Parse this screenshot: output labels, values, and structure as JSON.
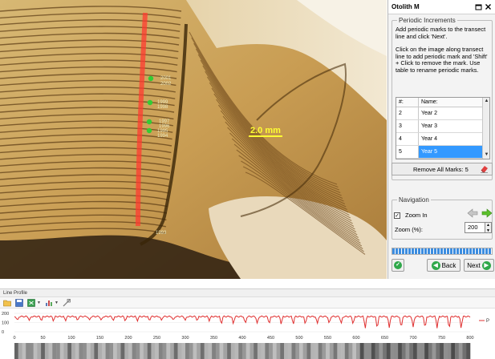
{
  "image": {
    "mark_labels": [
      "2001",
      "2002",
      "1999",
      "1998",
      "1997",
      "1996",
      "1995",
      "1994",
      "1993"
    ],
    "scale_label": "2.0 mm"
  },
  "panel": {
    "title": "Otolith M",
    "periodic": {
      "legend": "Periodic Increments",
      "instruction1": "Add periodic marks to the transect line and click 'Next'.",
      "instruction2": "Click on the image along transect line to add periodic mark and 'Shift' + Click to remove the mark. Use table to rename periodic marks.",
      "table": {
        "col_num": "#:",
        "col_name": "Name:",
        "rows": [
          {
            "num": "2",
            "name": "Year 2"
          },
          {
            "num": "3",
            "name": "Year 3"
          },
          {
            "num": "4",
            "name": "Year 4"
          },
          {
            "num": "5",
            "name": "Year 5"
          }
        ],
        "selected_index": 3
      },
      "remove_label": "Remove All Marks: 5"
    },
    "navigation": {
      "legend": "Navigation",
      "zoom_in_label": "Zoom In",
      "zoom_in_checked": true,
      "zoom_label": "Zoom (%):",
      "zoom_value": "200"
    },
    "progress_fraction": 1.0,
    "back_label": "Back",
    "next_label": "Next"
  },
  "line_profile": {
    "title": "Line Profile",
    "y_ticks": [
      "200",
      "100",
      "0"
    ],
    "x_ticks": [
      "0",
      "50",
      "100",
      "150",
      "200",
      "250",
      "300",
      "350",
      "400",
      "450",
      "500",
      "550",
      "600",
      "650",
      "700",
      "750",
      "800"
    ],
    "legend_label": "P",
    "series_color": "#e03030"
  },
  "colors": {
    "transect": "#ff3b30",
    "mark_green": "#33cc33",
    "scale": "#ffff33",
    "accent_blue": "#3399ff",
    "button_green": "#2fa84a"
  },
  "icons": [
    "close-icon",
    "restore-icon",
    "eraser-icon",
    "arrow-left-icon",
    "arrow-right-icon",
    "back-arrow-icon",
    "next-arrow-icon",
    "open-folder-icon",
    "save-icon",
    "export-icon",
    "chart-icon",
    "settings-icon"
  ]
}
